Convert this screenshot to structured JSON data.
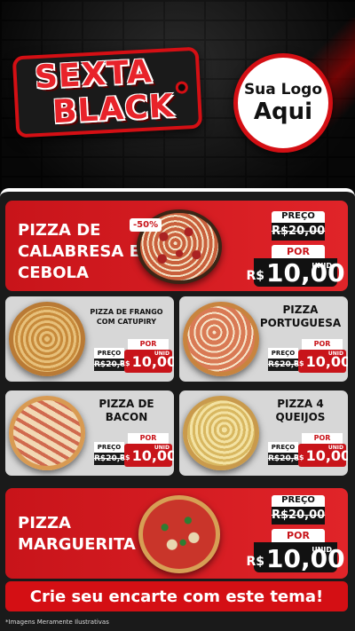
{
  "header": {
    "tag_line1": "SEXTA",
    "tag_line2": "BLACK",
    "logo_line1": "Sua Logo",
    "logo_line2": "Aqui"
  },
  "colors": {
    "accent": "#d40f14",
    "dark": "#111111",
    "card_light": "#d7d7d7"
  },
  "featured": [
    {
      "name": "PIZZA DE CALABRESA E CEBOLA",
      "badge": "-50%",
      "preco_label": "PREÇO",
      "old_price": "R$20,00",
      "por_label": "POR",
      "currency": "R$",
      "new_price": "10,00",
      "unit": "UNID"
    },
    {
      "name": "PIZZA MARGUERITA",
      "preco_label": "PREÇO",
      "old_price": "R$20,00",
      "por_label": "POR",
      "currency": "R$",
      "new_price": "10,00",
      "unit": "UNID"
    }
  ],
  "items": [
    {
      "name": "PIZZA DE FRANGO COM CATUPIRY",
      "preco_label": "PREÇO",
      "old_price": "R$20,00",
      "por_label": "POR",
      "currency": "R$",
      "new_price": "10,00",
      "unit": "UNID"
    },
    {
      "name": "PIZZA PORTUGUESA",
      "preco_label": "PREÇO",
      "old_price": "R$20,00",
      "por_label": "POR",
      "currency": "R$",
      "new_price": "10,00",
      "unit": "UNID"
    },
    {
      "name": "PIZZA DE BACON",
      "preco_label": "PREÇO",
      "old_price": "R$20,00",
      "por_label": "POR",
      "currency": "R$",
      "new_price": "10,00",
      "unit": "UNID"
    },
    {
      "name": "PIZZA 4 QUEIJOS",
      "preco_label": "PREÇO",
      "old_price": "R$20,00",
      "por_label": "POR",
      "currency": "R$",
      "new_price": "10,00",
      "unit": "UNID"
    }
  ],
  "cta": "Crie seu encarte com este tema!",
  "footnote": "*Imagens Meramente Ilustrativas"
}
